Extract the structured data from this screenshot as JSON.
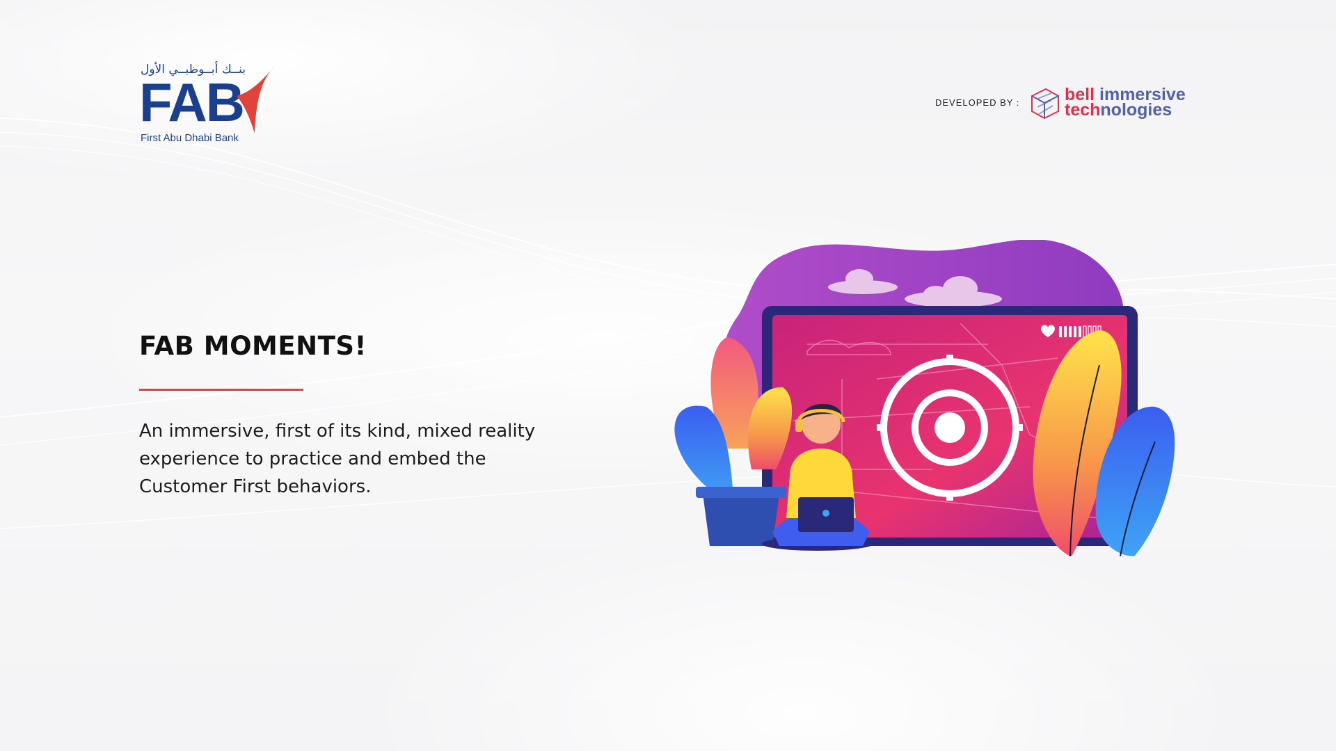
{
  "brand": {
    "arabic_name": "بنــك أبــوظبــي الأول",
    "wordmark": "FAB",
    "full_name": "First Abu Dhabi Bank"
  },
  "developer": {
    "label": "DEVELOPED BY :",
    "name_line1_a": "bell",
    "name_line1_b": " immersive",
    "name_line2_a": "tech",
    "name_line2_b": "nologies"
  },
  "main": {
    "title": "FAB MOMENTS!",
    "description": "An immersive, first of its kind, mixed reality experience to practice and embed the Customer First behaviors."
  },
  "colors": {
    "fab_blue": "#1b3f8f",
    "fab_red": "#e3423a",
    "bell_red": "#d9324f",
    "bell_blue": "#5162a8"
  },
  "illustration": {
    "icon": "gamer-target-illustration"
  }
}
